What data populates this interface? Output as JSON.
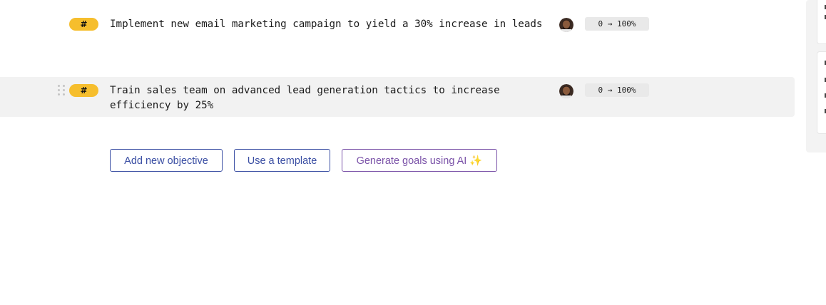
{
  "objectives": [
    {
      "badge": "#",
      "text": "Implement new email marketing campaign to yield a 30% increase in leads",
      "progress": "0 → 100%",
      "owner_avatar": "person-avatar"
    },
    {
      "badge": "#",
      "text": "Train sales team on advanced lead generation tactics to increase efficiency by 25%",
      "progress": "0 → 100%",
      "owner_avatar": "person-avatar"
    }
  ],
  "actions": {
    "add_objective": "Add new objective",
    "use_template": "Use a template",
    "generate_ai": "Generate goals using AI",
    "generate_ai_icon": "✨"
  },
  "colors": {
    "badge": "#f6be2d",
    "primary_button": "#3a4ea3",
    "ai_button": "#7a52a8",
    "row_highlight": "#f2f2f2"
  }
}
